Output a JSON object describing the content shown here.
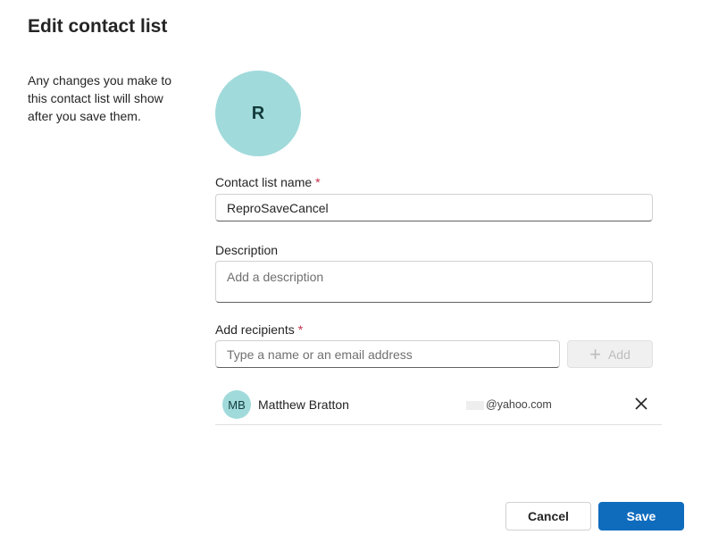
{
  "dialog": {
    "title": "Edit contact list",
    "helper_text": "Any changes you make to this contact list will show after you save them."
  },
  "list_avatar": {
    "initial": "R",
    "color": "#a1dadb"
  },
  "fields": {
    "name": {
      "label": "Contact list name",
      "required_mark": "*",
      "value": "ReproSaveCancel"
    },
    "description": {
      "label": "Description",
      "placeholder": "Add a description",
      "value": ""
    },
    "recipients": {
      "label": "Add recipients",
      "required_mark": "*",
      "placeholder": "Type a name or an email address",
      "add_label": "Add"
    }
  },
  "members": [
    {
      "initials": "MB",
      "name": "Matthew Bratton",
      "email": "@yahoo.com"
    }
  ],
  "footer": {
    "cancel_label": "Cancel",
    "save_label": "Save"
  },
  "colors": {
    "primary": "#0f6cbd",
    "required": "#c4314b",
    "avatar": "#a1dadb"
  }
}
